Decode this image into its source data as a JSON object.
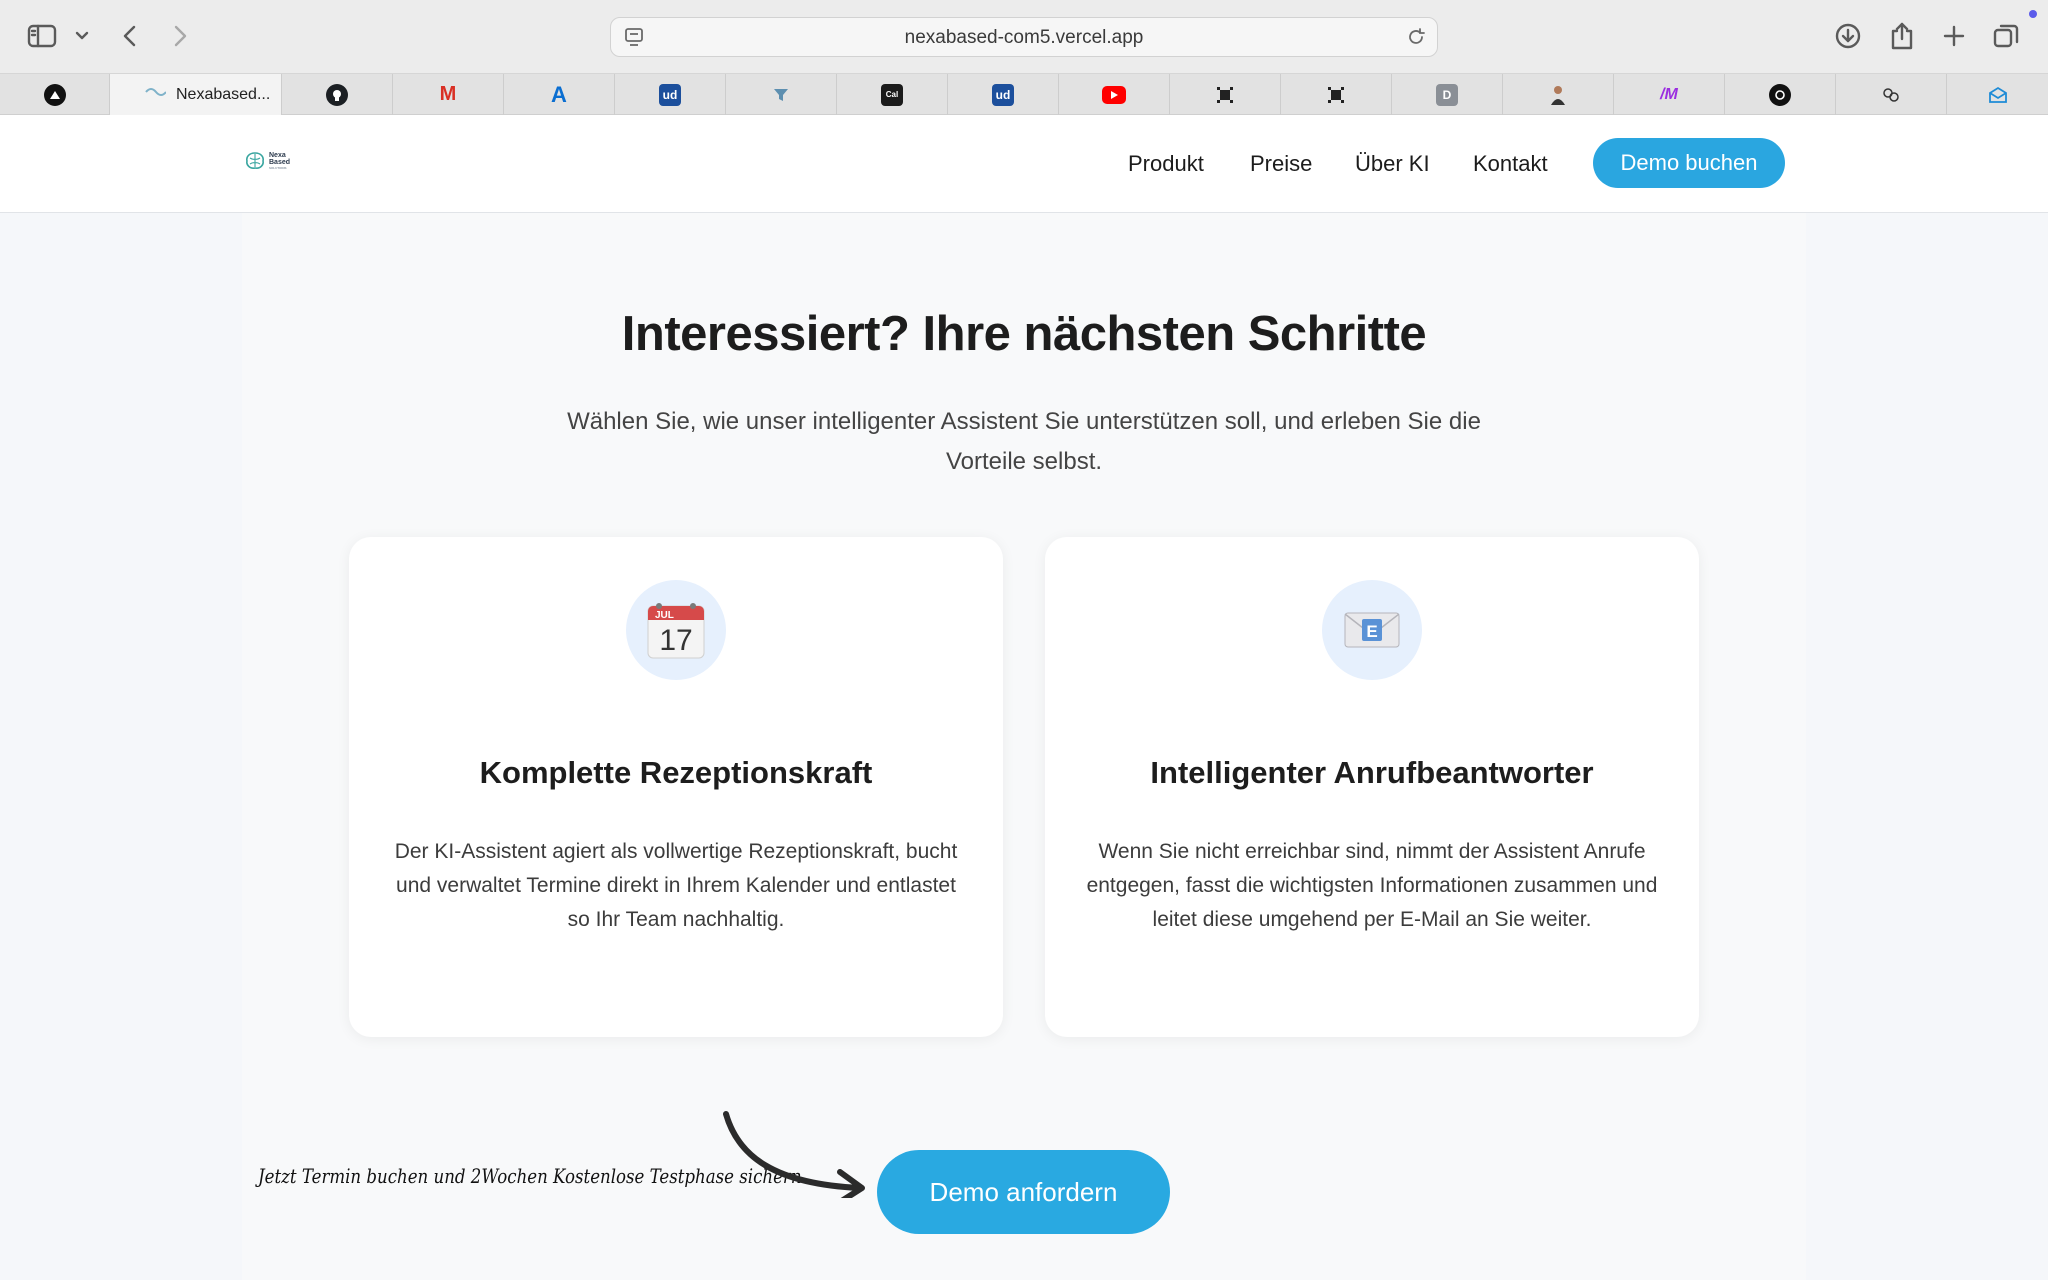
{
  "browser": {
    "url": "nexabased-com5.vercel.app",
    "active_tab_title": "Nexabased...",
    "tabs": [
      {
        "icon": "triangle-logo-icon",
        "label": ""
      },
      {
        "icon": "nexabased-favicon",
        "label": "Nexabased..."
      },
      {
        "icon": "github-icon",
        "label": ""
      },
      {
        "icon": "gmail-icon",
        "label": "M"
      },
      {
        "icon": "azure-icon",
        "label": "A"
      },
      {
        "icon": "udemy-icon",
        "label": "ud"
      },
      {
        "icon": "funnel-icon",
        "label": ""
      },
      {
        "icon": "cal-icon",
        "label": "Cal"
      },
      {
        "icon": "udemy-icon",
        "label": "ud"
      },
      {
        "icon": "youtube-icon",
        "label": ""
      },
      {
        "icon": "grid-chip-icon",
        "label": ""
      },
      {
        "icon": "grid-chip-icon",
        "label": ""
      },
      {
        "icon": "d-letter-icon",
        "label": "D"
      },
      {
        "icon": "person-avatar-icon",
        "label": ""
      },
      {
        "icon": "make-icon",
        "label": "/M"
      },
      {
        "icon": "openai-icon",
        "label": ""
      },
      {
        "icon": "brain-icon",
        "label": ""
      },
      {
        "icon": "mail-open-icon",
        "label": ""
      }
    ]
  },
  "header": {
    "logo_line1": "Nexa",
    "logo_line2": "Based",
    "logo_line3": "SOLUTIONS",
    "nav": [
      "Produkt",
      "Preise",
      "Über KI",
      "Kontakt"
    ],
    "demo_button": "Demo buchen"
  },
  "section": {
    "title": "Interessiert? Ihre nächsten Schritte",
    "subtitle": "Wählen Sie, wie unser intelligenter Assistent Sie unterstützen soll, und erleben Sie die Vorteile selbst."
  },
  "cards": [
    {
      "icon": "calendar-icon",
      "calendar_month": "JUL",
      "calendar_day": "17",
      "title": "Komplette Rezeptionskraft",
      "text": "Der KI-Assistent agiert als vollwertige Rezeptionskraft, bucht und verwaltet Termine direkt in Ihrem Kalender und entlastet so Ihr Team nachhaltig."
    },
    {
      "icon": "envelope-icon",
      "envelope_letter": "E",
      "title": "Intelligenter Anrufbeantworter",
      "text": "Wenn Sie nicht erreichbar sind, nimmt der Assistent Anrufe entgegen, fasst die wichtigsten Informationen zusammen und leitet diese umgehend per E-Mail an Sie weiter."
    }
  ],
  "cta": {
    "handwritten_note": "Jetzt Termin buchen und 2Wochen Kostenlose Testphase sichern",
    "button": "Demo anfordern"
  },
  "colors": {
    "accent": "#2aa6e0",
    "page_bg": "#f5f7fa",
    "card_bg": "#ffffff",
    "icon_circle": "#e6f0fd"
  }
}
